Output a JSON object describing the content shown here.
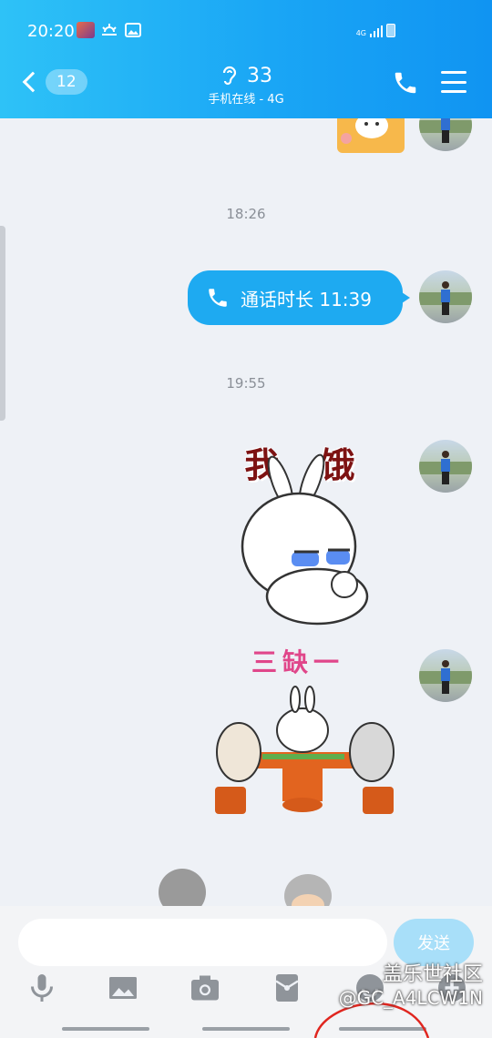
{
  "status_bar": {
    "time": "20:20",
    "network": "4G"
  },
  "header": {
    "unread_count": "12",
    "contact_name": "33",
    "contact_status": "手机在线 - 4G"
  },
  "messages": {
    "timestamp_1": "18:26",
    "call_text": "通话时长 11:39",
    "timestamp_2": "19:55",
    "sticker_1_caption": "我 饿 了",
    "sticker_2_caption": "三缺一"
  },
  "input": {
    "placeholder": "",
    "send_label": "发送"
  },
  "toolbar": {
    "icons": [
      "microphone-icon",
      "image-icon",
      "camera-icon",
      "red-packet-icon",
      "emoji-icon",
      "plus-icon"
    ]
  },
  "watermark": {
    "line1": "盖乐世社区",
    "line2": "@GC_A4LCW1N"
  },
  "colors": {
    "header": "#1aa6f5",
    "bubble": "#1eaaf1",
    "send": "#a8dff9"
  }
}
